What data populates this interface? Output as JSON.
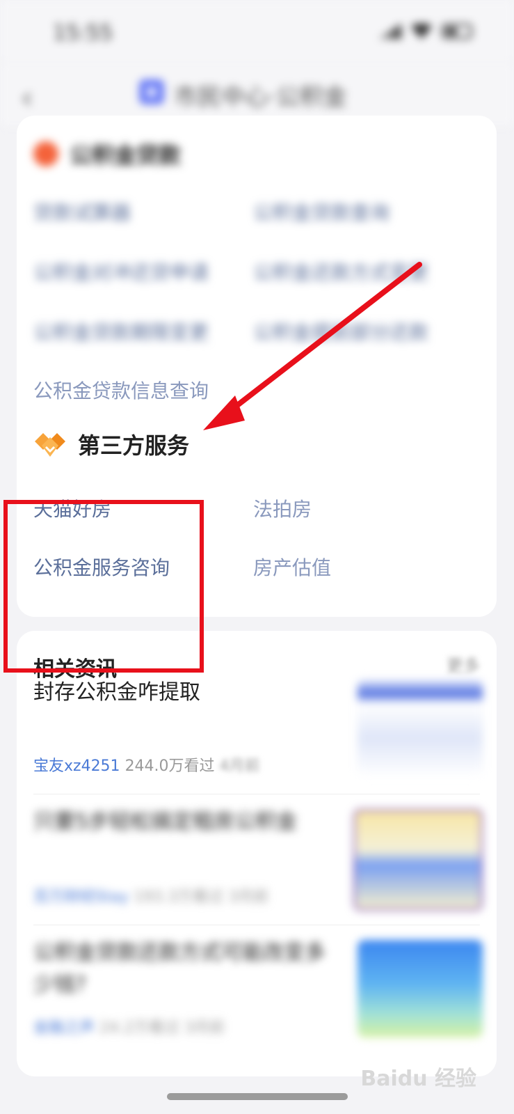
{
  "status": {
    "time": "15:55"
  },
  "nav": {
    "title": "市民中心·公积金"
  },
  "loan_section": {
    "title": "公积金贷款",
    "items": [
      {
        "label": "贷款试算器"
      },
      {
        "label": "公积金贷款查询"
      },
      {
        "label": "公积金对冲还贷申请"
      },
      {
        "label": "公积金还款方式变更"
      },
      {
        "label": "公积金贷款期限变更"
      },
      {
        "label": "公积金提前部分还款"
      }
    ],
    "last_item": "公积金贷款信息查询"
  },
  "third_party": {
    "title": "第三方服务",
    "items": [
      {
        "label": "天猫好房"
      },
      {
        "label": "法拍房"
      },
      {
        "label": "公积金服务咨询"
      },
      {
        "label": "房产估值"
      }
    ]
  },
  "news": {
    "heading": "相关资讯",
    "more": "更多",
    "items": [
      {
        "title": "封存公积金咋提取",
        "author": "宝友xz4251",
        "views": "244.0万看过",
        "time": "4月前"
      },
      {
        "title": "只要5步轻松搞定租房公积金",
        "author": "百万财经Stay",
        "views": "193.3万看过",
        "time": "3月前"
      },
      {
        "title": "公积金贷款还款方式可能改变多少钱?",
        "author": "金融之声",
        "views": "24.2万看过",
        "time": "3月前"
      }
    ]
  },
  "watermark": "Baidu 经验"
}
